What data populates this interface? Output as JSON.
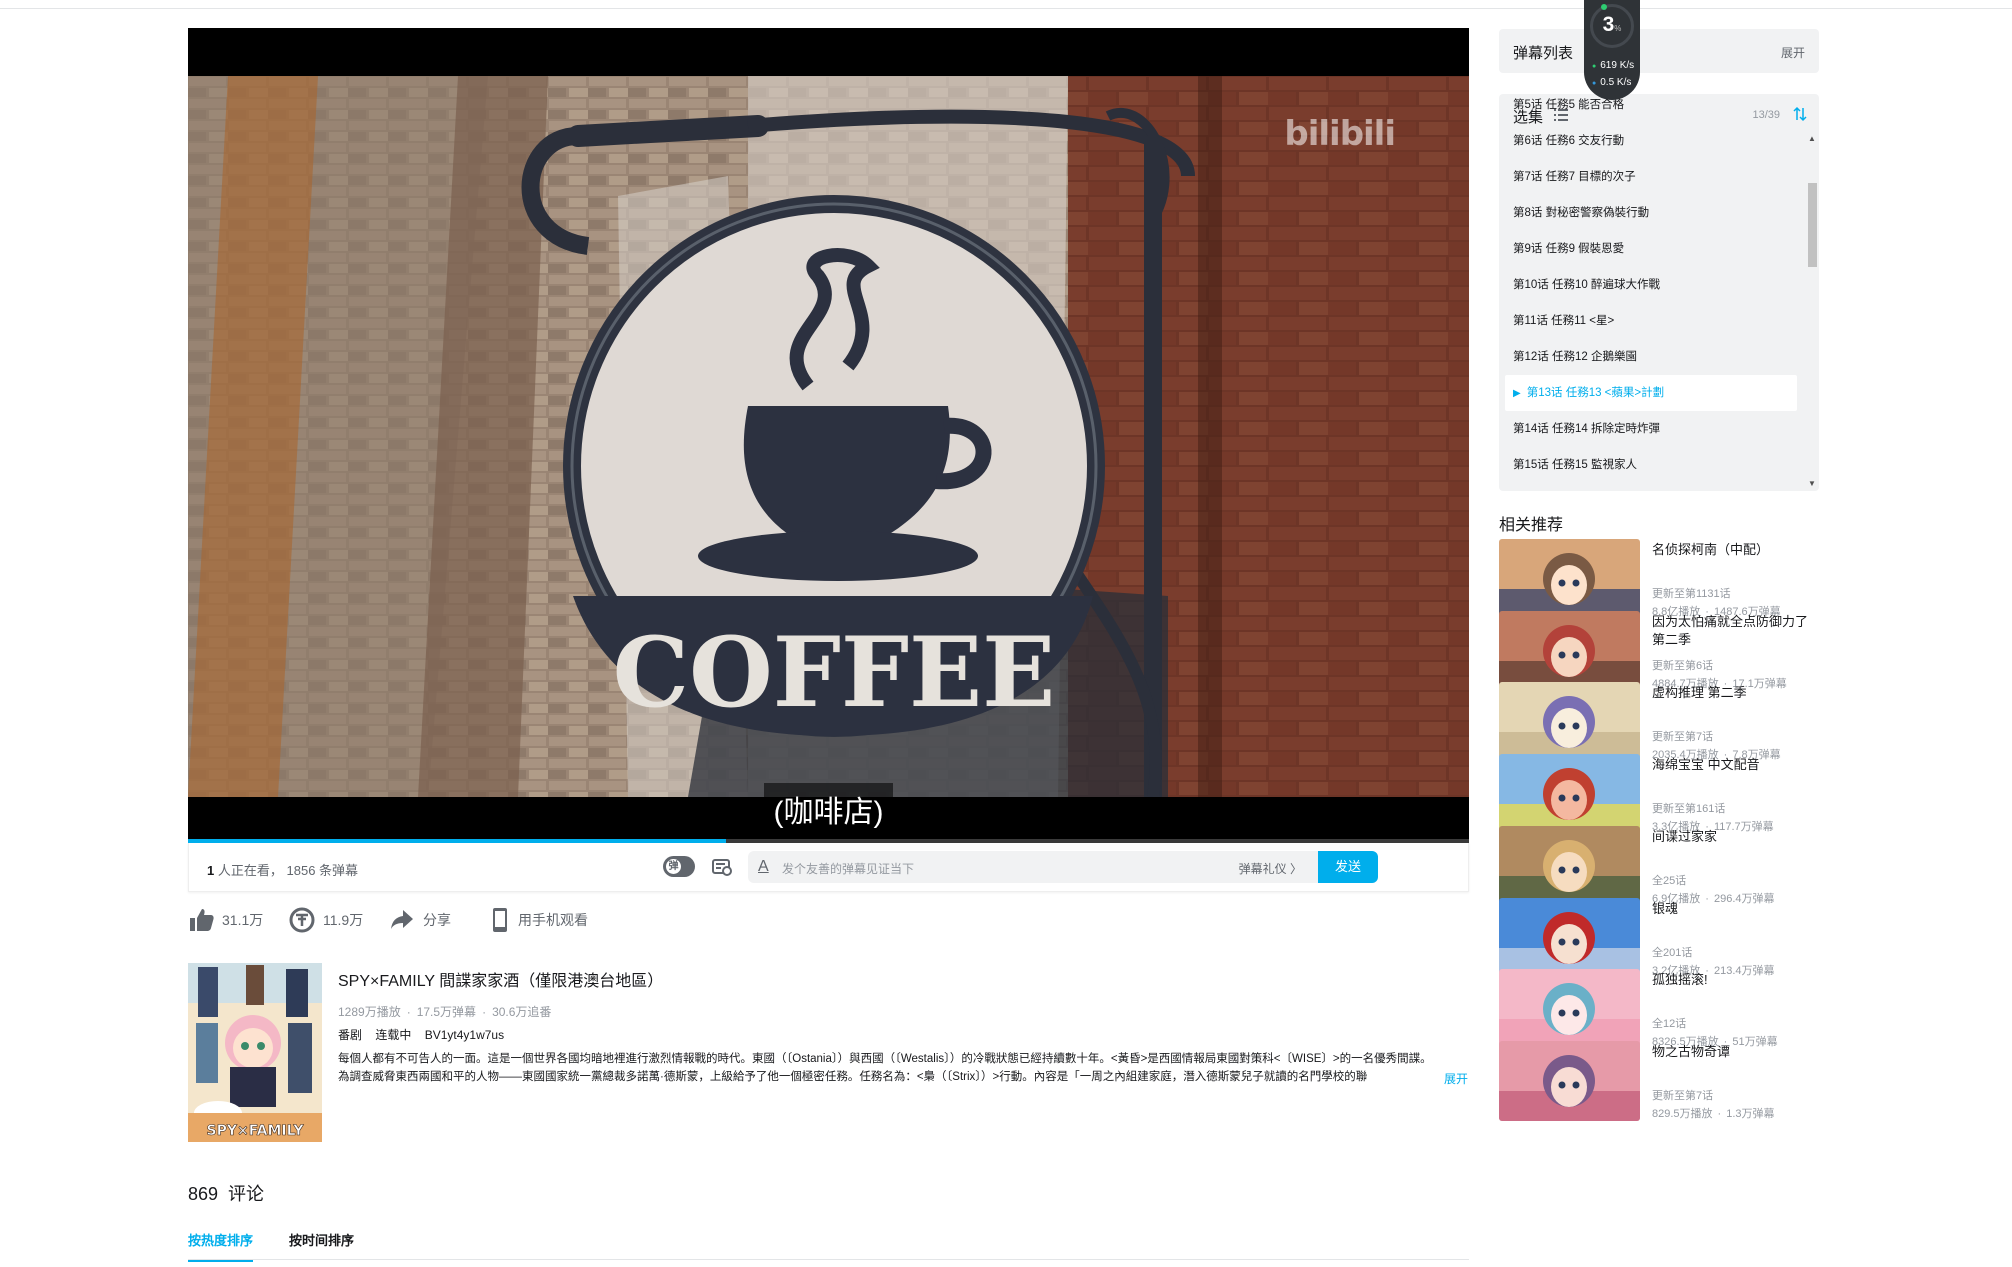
{
  "player": {
    "watermark": "bilibili",
    "sign_text": "COFFEE",
    "subtitle": "(咖啡店)",
    "progress_fraction": 0.42
  },
  "sendbar": {
    "viewers": "1",
    "viewers_suffix": "人正在看，",
    "danmaku_count": "1856",
    "danmaku_suffix": "条弹幕",
    "toggle_label": "弹",
    "input_placeholder": "发个友善的弹幕见证当下",
    "etiquette": "弹幕礼仪 〉",
    "send_label": "发送"
  },
  "toolbar": {
    "like": "31.1万",
    "coin": "11.9万",
    "share": "分享",
    "phone": "用手机观看"
  },
  "media": {
    "title": "SPY×FAMILY 間諜家家酒（僅限港澳台地區）",
    "plays": "1289万播放",
    "danmaku": "17.5万弹幕",
    "follows": "30.6万追番",
    "tags": [
      "番剧",
      "连载中",
      "BV1yt4y1w7us"
    ],
    "description": "每個人都有不可告人的一面。這是一個世界各國均暗地裡進行激烈情報戰的時代。東國（〔Ostania〕）與西國（〔Westalis〕）的冷戰狀態已經持續數十年。<黃昏>是西國情報局東國對策科<〔WISE〕>的一名優秀間諜。為調查威脅東西兩國和平的人物——東國國家統一黨總裁多諾萬·德斯蒙，上級給予了他一個極密任務。任務名為：<梟（〔Strix〕）>行動。內容是「一周之內組建家庭，潛入德斯蒙兒子就讀的名門學校的聯",
    "expand": "展开",
    "poster_text": "SPY×FAMILY"
  },
  "comments": {
    "count": "869",
    "label": "评论",
    "sort_hot": "按热度排序",
    "sort_time": "按时间排序"
  },
  "danmaku_list": {
    "title": "弹幕列表",
    "expand": "展开"
  },
  "episodes": {
    "title": "选集",
    "count": "13/39",
    "items": [
      "第5话 任務5 能否合格",
      "第6话 任務6 交友行動",
      "第7话 任務7 目標的次子",
      "第8话 對秘密警察偽裝行動",
      "第9话 任務9 假裝恩愛",
      "第10话 任務10 醉遍球大作戰",
      "第11话 任務11 <星>",
      "第12话 任務12 企鵝樂園",
      "第13话 任務13 <蘋果>計劃",
      "第14话 任務14 拆除定時炸彈",
      "第15话 任務15 監視家人"
    ],
    "active_index": 8
  },
  "recommend": {
    "title": "相关推荐",
    "items": [
      {
        "name": "名侦探柯南（中配）",
        "update": "更新至第1131话",
        "plays": "8.8亿播放",
        "danmaku": "1487.6万弹幕"
      },
      {
        "name": "因为太怕痛就全点防御力了 第二季",
        "update": "更新至第6话",
        "plays": "4884.7万播放",
        "danmaku": "17.1万弹幕"
      },
      {
        "name": "虚构推理 第二季",
        "update": "更新至第7话",
        "plays": "2035.4万播放",
        "danmaku": "7.8万弹幕"
      },
      {
        "name": "海绵宝宝 中文配音",
        "update": "更新至第161话",
        "plays": "3.3亿播放",
        "danmaku": "117.7万弹幕"
      },
      {
        "name": "间谍过家家",
        "update": "全25话",
        "plays": "6.9亿播放",
        "danmaku": "296.4万弹幕"
      },
      {
        "name": "银魂",
        "update": "全201话",
        "plays": "3.2亿播放",
        "danmaku": "213.4万弹幕"
      },
      {
        "name": "孤独摇滚!",
        "update": "全12话",
        "plays": "8326.5万播放",
        "danmaku": "51万弹幕"
      },
      {
        "name": "物之古物奇谭",
        "update": "更新至第7话",
        "plays": "829.5万播放",
        "danmaku": "1.3万弹幕"
      }
    ]
  },
  "speed_widget": {
    "percent": "3",
    "percent_unit": "%",
    "upload": "619 K/s",
    "download": "0.5 K/s"
  },
  "colors": {
    "accent": "#00aeec",
    "text": "#18191c",
    "muted": "#9499a0",
    "panel_bg": "#f1f2f3"
  }
}
